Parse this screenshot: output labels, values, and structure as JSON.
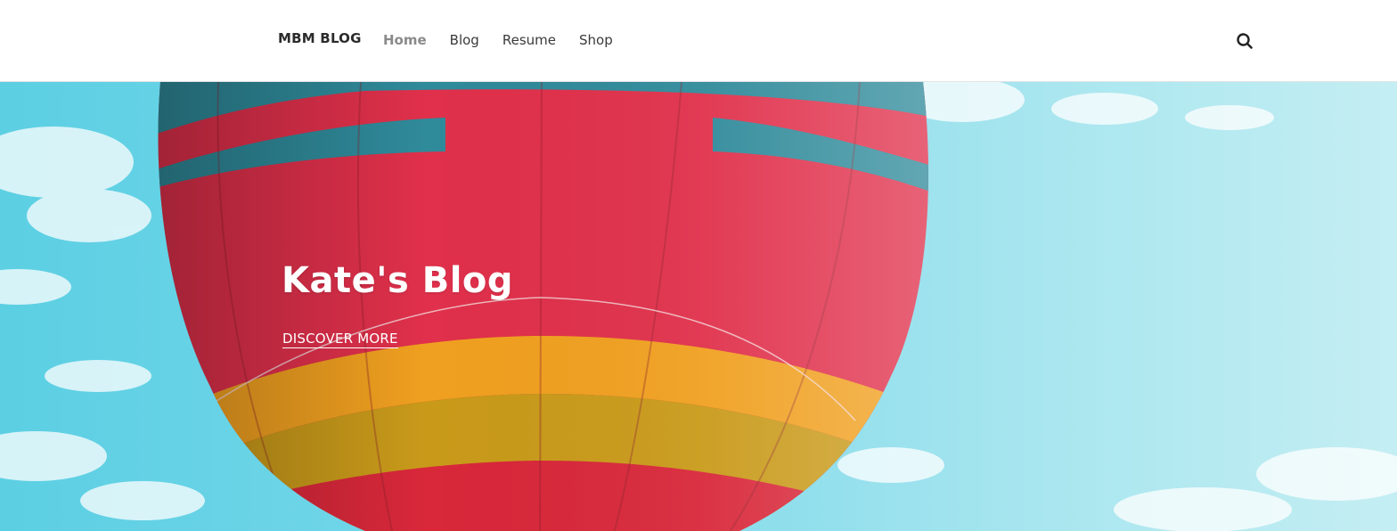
{
  "site": {
    "brand": "MBM BLOG"
  },
  "nav": {
    "items": [
      {
        "label": "Home",
        "active": true
      },
      {
        "label": "Blog",
        "active": false
      },
      {
        "label": "Resume",
        "active": false
      },
      {
        "label": "Shop",
        "active": false
      }
    ]
  },
  "header": {
    "search_icon": "search-icon"
  },
  "hero": {
    "title": "Kate's Blog",
    "cta_label": "DISCOVER MORE",
    "background": "hot-air-balloon-photo",
    "colors": {
      "sky": "#7ad8ea",
      "balloon_red": "#e0304b",
      "balloon_teal": "#2f8a9a",
      "balloon_orange": "#f0a020"
    }
  }
}
